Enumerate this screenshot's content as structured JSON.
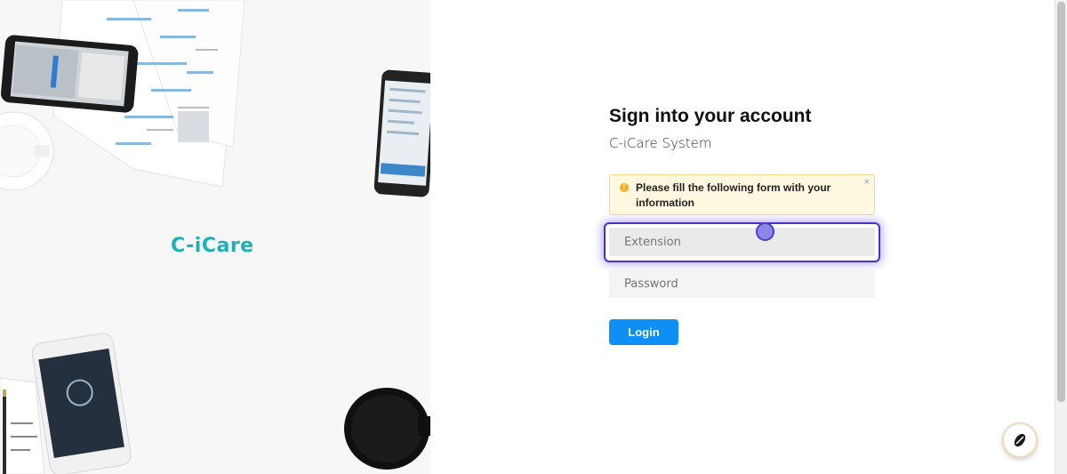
{
  "brand": {
    "logo_text": "C-iCare",
    "accent_color": "#19b2b8"
  },
  "form": {
    "title": "Sign into your account",
    "subtitle": "C-iCare System",
    "alert": {
      "text": "Please fill the following form with your information",
      "close_label": "×"
    },
    "extension_placeholder": "Extension",
    "password_placeholder": "Password",
    "login_label": "Login"
  },
  "colors": {
    "login_button": "#0d8ff5",
    "focus_ring": "#4b2fc9",
    "alert_bg": "#fff8e1"
  },
  "fab": {
    "icon": "bean-icon"
  }
}
